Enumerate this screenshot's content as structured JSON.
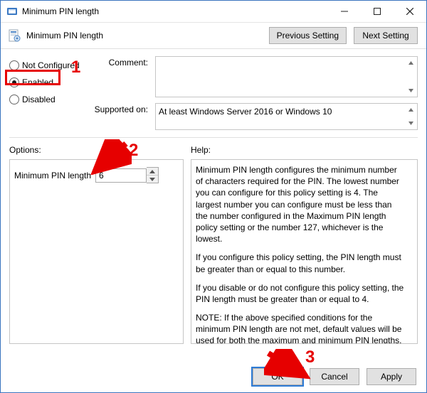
{
  "titlebar": {
    "title": "Minimum PIN length"
  },
  "subheader": {
    "policy_name": "Minimum PIN length",
    "prev_label": "Previous Setting",
    "next_label": "Next Setting"
  },
  "state": {
    "not_configured_label": "Not Configured",
    "enabled_label": "Enabled",
    "disabled_label": "Disabled",
    "selected": "enabled"
  },
  "comment": {
    "label": "Comment:",
    "value": ""
  },
  "supported": {
    "label": "Supported on:",
    "value": "At least Windows Server 2016 or Windows 10"
  },
  "labels": {
    "options": "Options:",
    "help": "Help:"
  },
  "options": {
    "min_pin_label": "Minimum PIN length",
    "min_pin_value": "6"
  },
  "help": {
    "p1": "Minimum PIN length configures the minimum number of characters required for the PIN.  The lowest number you can configure for this policy setting is 4.  The largest number you can configure must be less than the number configured in the Maximum PIN length policy setting or the number 127, whichever is the lowest.",
    "p2": "If you configure this policy setting, the PIN length must be greater than or equal to this number.",
    "p3": "If you disable or do not configure this policy setting, the PIN length must be greater than or equal to 4.",
    "p4": "NOTE: If the above specified conditions for the minimum PIN length are not met, default values will be used for both the maximum and minimum PIN lengths."
  },
  "footer": {
    "ok": "OK",
    "cancel": "Cancel",
    "apply": "Apply"
  },
  "annotations": {
    "n1": "1",
    "n2": "2",
    "n3": "3"
  }
}
